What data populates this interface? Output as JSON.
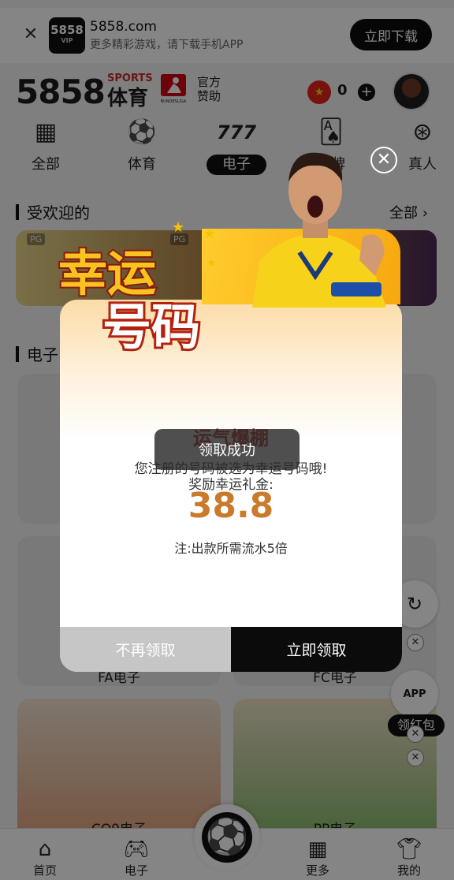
{
  "download_banner": {
    "logo_text": "5858",
    "logo_sub": "VIP",
    "domain": "5858.com",
    "subtitle": "更多精彩游戏，请下载手机APP",
    "button": "立即下载"
  },
  "header": {
    "brand": "5858",
    "brand_sports": "SPORTS",
    "brand_tiyu": "体育",
    "bundesliga": "BUNDESLIGA",
    "sponsor": [
      "官方",
      "赞助"
    ],
    "balance": "0"
  },
  "categories": [
    {
      "label": "全部",
      "icon": "grid-icon"
    },
    {
      "label": "体育",
      "icon": "soccer-ball-icon"
    },
    {
      "label": "电子",
      "icon": "slot-777-icon",
      "active": true
    },
    {
      "label": "棋牌",
      "icon": "cards-icon"
    },
    {
      "label": "真人",
      "icon": "roulette-icon"
    }
  ],
  "sections": {
    "popular": "受欢迎的",
    "see_all": "全部",
    "electronic": "电子"
  },
  "tiles": {
    "pg_tag": "PG",
    "fa": "FA电子",
    "fc": "FC电子",
    "cq9": "CQ9电子",
    "pp": "PP电子"
  },
  "bottom_nav": [
    {
      "label": "首页",
      "icon": "home-icon"
    },
    {
      "label": "电子",
      "icon": "gamepad-icon"
    },
    {
      "label": "更多",
      "icon": "grid-icon"
    },
    {
      "label": "我的",
      "icon": "jersey-icon"
    }
  ],
  "side": {
    "app_label": "APP",
    "red_packet": "领红包"
  },
  "modal": {
    "title_art": [
      "幸运",
      "号码"
    ],
    "headline": "运气爆棚",
    "message": "您注册的号码被选为幸运号码哦!",
    "reward_label": "奖励幸运礼金:",
    "reward_amount": "38.8",
    "note": "注:出款所需流水5倍",
    "decline": "不再领取",
    "claim": "立即领取",
    "toast": "领取成功"
  }
}
